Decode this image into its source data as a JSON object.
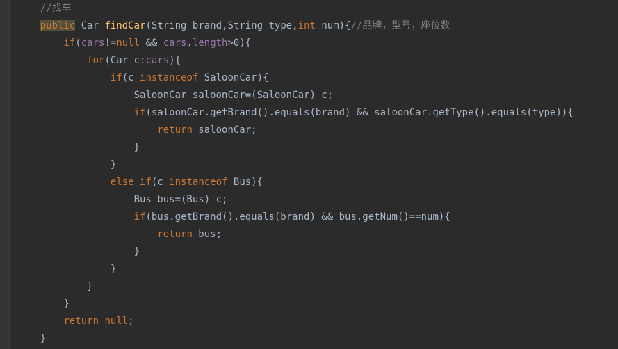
{
  "code": {
    "l1_comment": "//找车",
    "l2_kw_public": "public",
    "l2_type_car": " Car ",
    "l2_method": "findCar",
    "l2_sig1": "(String brand,String type,",
    "l2_kw_int": "int",
    "l2_sig2": " num){",
    "l2_comment": "//品牌，型号，座位数",
    "l3_kw_if": "if",
    "l3_p1": "(",
    "l3_field1": "cars",
    "l3_op1": "!=",
    "l3_kw_null": "null",
    "l3_op2": " && ",
    "l3_field2": "cars",
    "l3_dot": ".",
    "l3_field3": "length",
    "l3_op3": ">",
    "l3_num": "0",
    "l3_p2": "){",
    "l4_kw_for": "for",
    "l4_p1": "(Car c:",
    "l4_field": "cars",
    "l4_p2": "){",
    "l5_kw_if": "if",
    "l5_p1": "(c ",
    "l5_kw_inst": "instanceof",
    "l5_p2": " SaloonCar){",
    "l6_text": "SaloonCar saloonCar=(SaloonCar) c;",
    "l7_kw_if": "if",
    "l7_text": "(saloonCar.getBrand().equals(brand) && saloonCar.getType().equals(type)){",
    "l8_kw_return": "return",
    "l8_text": " saloonCar;",
    "l9_brace": "}",
    "l10_brace": "}",
    "l11_kw_else": "else if",
    "l11_p1": "(c ",
    "l11_kw_inst": "instanceof",
    "l11_p2": " Bus){",
    "l12_text": "Bus bus=(Bus) c;",
    "l13_kw_if": "if",
    "l13_text": "(bus.getBrand().equals(brand) && bus.getNum()==num){",
    "l14_kw_return": "return",
    "l14_text": " bus;",
    "l15_brace": "}",
    "l16_brace": "}",
    "l17_brace": "}",
    "l18_brace": "}",
    "l19_kw_return": "return null",
    "l19_semi": ";",
    "l20_brace": "}"
  }
}
